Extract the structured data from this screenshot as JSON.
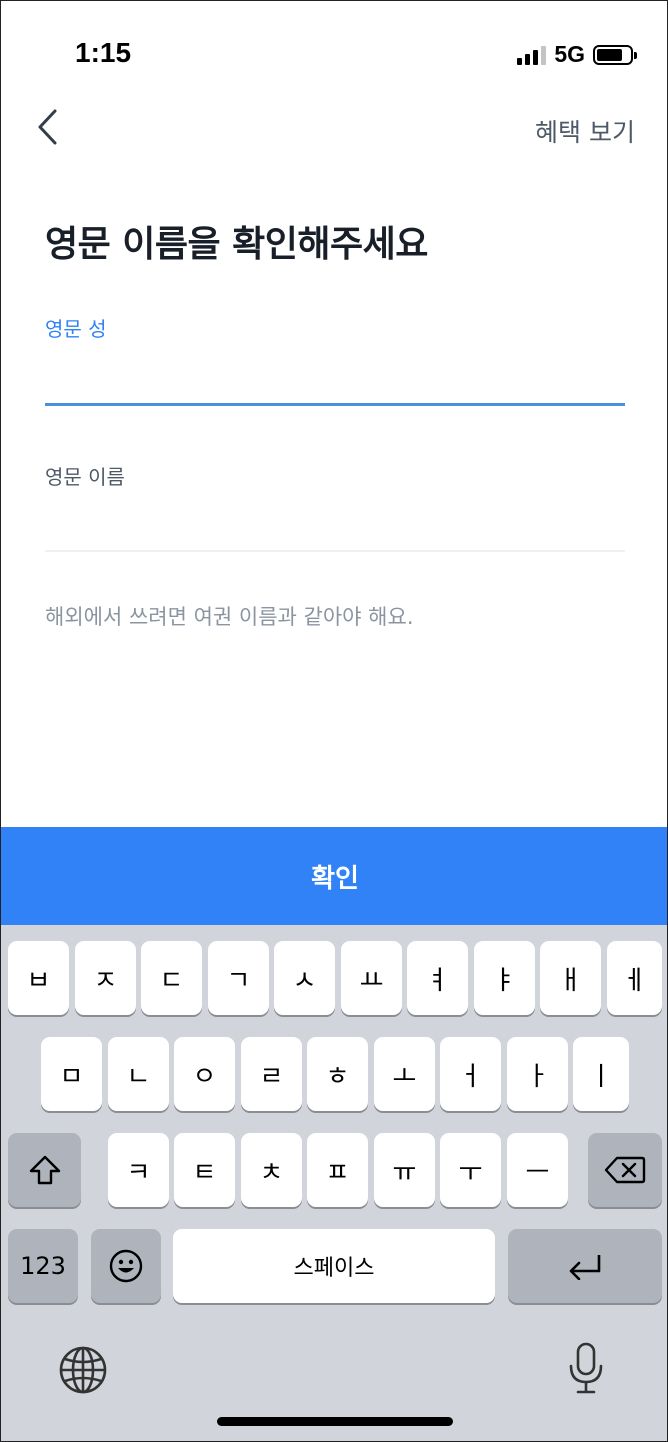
{
  "status": {
    "time": "1:15",
    "network": "5G",
    "icons": [
      "signal-icon",
      "battery-icon"
    ]
  },
  "nav": {
    "back_icon": "chevron-left-icon",
    "benefit_label": "혜택 보기"
  },
  "title": "영문 이름을 확인해주세요",
  "form": {
    "last_name": {
      "label": "영문 성",
      "value": ""
    },
    "first_name": {
      "label": "영문 이름",
      "value": ""
    },
    "helper": "해외에서 쓰려면 여권 이름과 같아야 해요."
  },
  "confirm_label": "확인",
  "keyboard": {
    "row1": [
      "ㅂ",
      "ㅈ",
      "ㄷ",
      "ㄱ",
      "ㅅ",
      "ㅛ",
      "ㅕ",
      "ㅑ",
      "ㅐ",
      "ㅔ"
    ],
    "row2": [
      "ㅁ",
      "ㄴ",
      "ㅇ",
      "ㄹ",
      "ㅎ",
      "ㅗ",
      "ㅓ",
      "ㅏ",
      "ㅣ"
    ],
    "row3": [
      "ㅋ",
      "ㅌ",
      "ㅊ",
      "ㅍ",
      "ㅠ",
      "ㅜ",
      "ㅡ"
    ],
    "numbers_label": "123",
    "space_label": "스페이스",
    "icons": [
      "shift-icon",
      "backspace-icon",
      "emoji-icon",
      "return-icon",
      "globe-icon",
      "microphone-icon"
    ]
  },
  "colors": {
    "accent": "#3182f6",
    "keyboard_bg": "#d1d4da",
    "key_gray": "#aeb3bc"
  }
}
